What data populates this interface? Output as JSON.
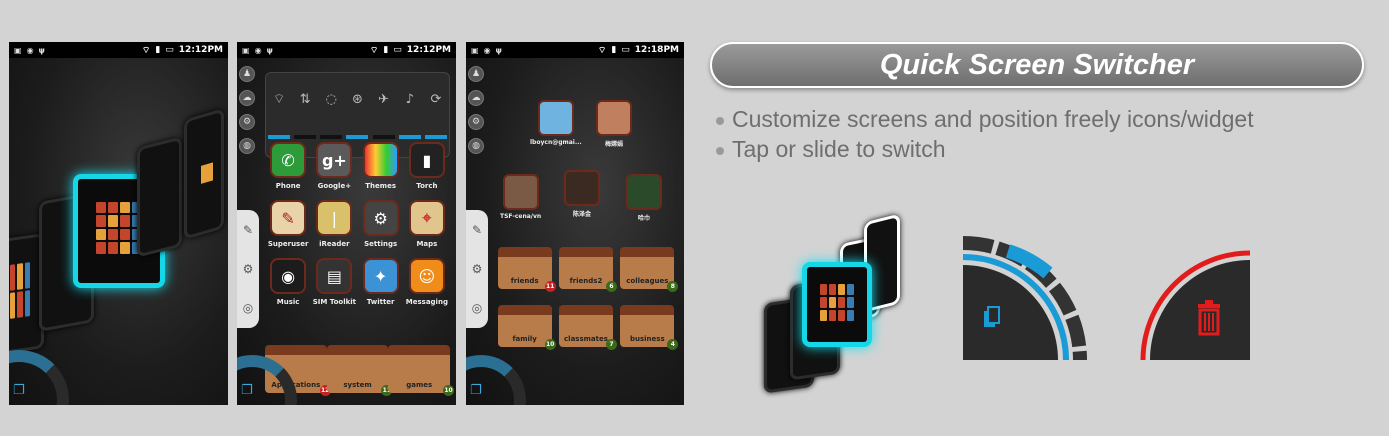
{
  "phones": [
    {
      "status_time": "12:12PM"
    },
    {
      "status_time": "12:12PM",
      "apps": [
        "Phone",
        "Google+",
        "Themes",
        "Torch",
        "Superuser",
        "iReader",
        "Settings",
        "Maps",
        "Music",
        "SIM Toolkit",
        "Twitter",
        "Messaging"
      ],
      "folders": [
        {
          "label": "Applications",
          "badge": "12",
          "badge_color": "red"
        },
        {
          "label": "system",
          "badge": "11",
          "badge_color": "green"
        },
        {
          "label": "games",
          "badge": "10",
          "badge_color": "green"
        }
      ]
    },
    {
      "status_time": "12:18PM",
      "contacts": [
        "lboycn@gmai...",
        "梅嫦娟",
        "TSF-cena/vn",
        "陈泽金",
        "哈巾"
      ],
      "folders": [
        {
          "label": "friends",
          "badge": "11",
          "badge_color": "red"
        },
        {
          "label": "friends2",
          "badge": "6",
          "badge_color": "green"
        },
        {
          "label": "colleagues",
          "badge": "8",
          "badge_color": "green"
        },
        {
          "label": "family",
          "badge": "10",
          "badge_color": "green"
        },
        {
          "label": "classmates",
          "badge": "7",
          "badge_color": "green"
        },
        {
          "label": "business",
          "badge": "4",
          "badge_color": "green"
        }
      ]
    }
  ],
  "feature": {
    "title": "Quick Screen Switcher",
    "bullets": [
      "Customize screens and position freely icons/widget",
      "Tap or slide to switch"
    ]
  },
  "colors": {
    "accent": "#15d7e8",
    "blue": "#1a9bd6",
    "trash": "#e21b1b"
  }
}
